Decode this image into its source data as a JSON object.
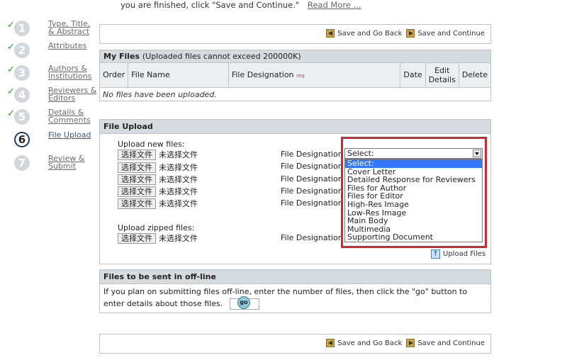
{
  "intro": {
    "text": "you are finished, click \"Save and Continue.\"",
    "read_more": "Read More ..."
  },
  "steps": [
    {
      "num": "1",
      "label": "Type, Title, & Abstract",
      "done": true
    },
    {
      "num": "2",
      "label": "Attributes",
      "done": true
    },
    {
      "num": "3",
      "label": "Authors & Institutions",
      "done": true
    },
    {
      "num": "4",
      "label": "Reviewers & Editors",
      "done": true
    },
    {
      "num": "5",
      "label": "Details & Comments",
      "done": true
    },
    {
      "num": "6",
      "label": "File Upload",
      "done": false,
      "current": true
    },
    {
      "num": "7",
      "label": "Review & Submit",
      "done": false
    }
  ],
  "nav": {
    "back_label": "Save and Go Back",
    "continue_label": "Save and Continue"
  },
  "my_files": {
    "title": "My Files",
    "note": "(Uploaded files cannot exceed 200000K)",
    "columns": [
      "Order",
      "File Name",
      "File Designation",
      "Date",
      "Edit Details",
      "Delete"
    ],
    "req": "req",
    "empty": "No files have been uploaded."
  },
  "file_upload": {
    "title": "File Upload",
    "new_files_label": "Upload new files:",
    "zipped_label": "Upload zipped files:",
    "choose_button": "选择文件",
    "no_file": "未选择文件",
    "designation_label": "File Designation",
    "selected": "Select:",
    "options": [
      "Select:",
      "Cover Letter",
      "Detailed Response for Reviewers",
      "Files for Author",
      "Files for Editor",
      "High-Res Image",
      "Low-Res Image",
      "Main Body",
      "Multimedia",
      "Supporting Document"
    ],
    "upload_button": "Upload Files"
  },
  "offline": {
    "title": "Files to be sent in off-line",
    "text": "If you plan on submitting files off-line, enter the number of files, then click the \"go\" button to enter details about those files.",
    "go_label": "go"
  },
  "colors": {
    "accent_red": "#d9232f",
    "highlight": "#3377ff",
    "check": "#2a9a2a"
  }
}
